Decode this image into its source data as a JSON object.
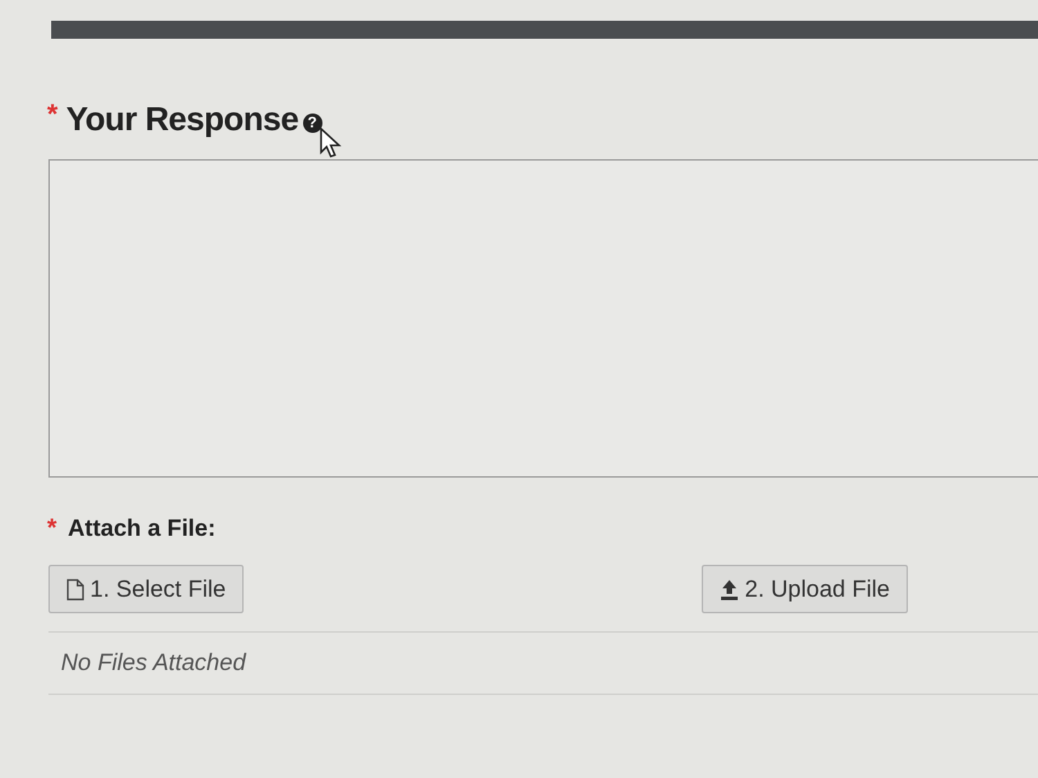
{
  "response": {
    "required_mark": "*",
    "label": "Your Response",
    "help_icon": "?"
  },
  "attachment": {
    "required_mark": "*",
    "label": "Attach a File:",
    "buttons": [
      {
        "kind": "select",
        "label": "1. Select File"
      },
      {
        "kind": "upload",
        "label": "2. Upload File"
      }
    ],
    "status": "No Files Attached"
  }
}
